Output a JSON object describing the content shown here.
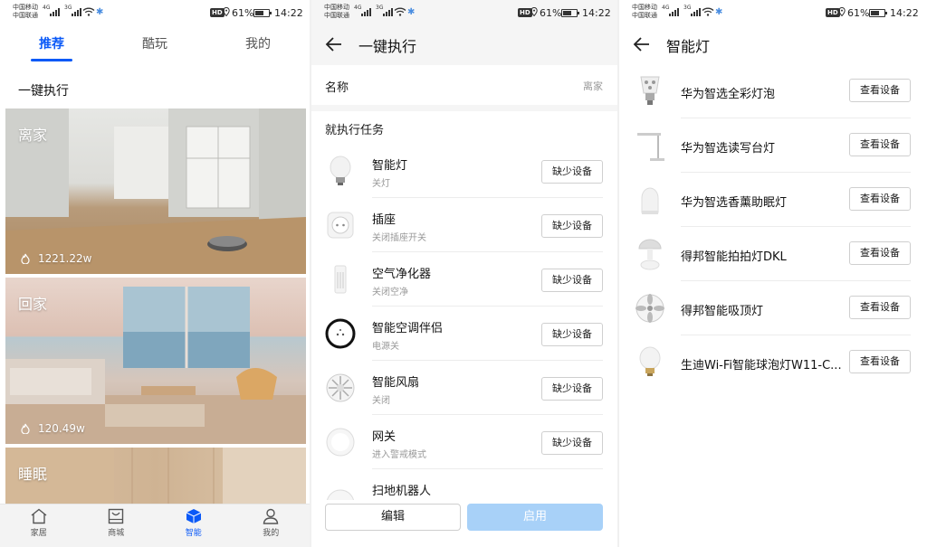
{
  "status": {
    "carrier1": "中国移动",
    "carrier2": "中国联通",
    "net1": "4G",
    "net2": "3G",
    "hd": "HD",
    "battery_pct": "61%",
    "time": "14:22"
  },
  "screen1": {
    "tabs": [
      {
        "label": "推荐",
        "active": true
      },
      {
        "label": "酷玩",
        "active": false
      },
      {
        "label": "我的",
        "active": false
      }
    ],
    "heading": "一键执行",
    "scenes": [
      {
        "name": "离家",
        "count": "1221.22w"
      },
      {
        "name": "回家",
        "count": "120.49w"
      },
      {
        "name": "睡眠",
        "count": ""
      }
    ],
    "bottom_nav": [
      {
        "label": "家居",
        "icon": "home-icon",
        "active": false
      },
      {
        "label": "商城",
        "icon": "store-icon",
        "active": false
      },
      {
        "label": "智能",
        "icon": "smart-cube-icon",
        "active": true
      },
      {
        "label": "我的",
        "icon": "profile-icon",
        "active": false
      }
    ]
  },
  "screen2": {
    "title": "一键执行",
    "name_label": "名称",
    "name_value": "离家",
    "tasks_heading": "就执行任务",
    "tasks": [
      {
        "name": "智能灯",
        "action": "关灯",
        "button": "缺少设备",
        "icon": "bulb-icon"
      },
      {
        "name": "插座",
        "action": "关闭插座开关",
        "button": "缺少设备",
        "icon": "socket-icon"
      },
      {
        "name": "空气净化器",
        "action": "关闭空净",
        "button": "缺少设备",
        "icon": "air-purifier-icon"
      },
      {
        "name": "智能空调伴侣",
        "action": "电源关",
        "button": "缺少设备",
        "icon": "ac-companion-icon"
      },
      {
        "name": "智能风扇",
        "action": "关闭",
        "button": "缺少设备",
        "icon": "fan-icon"
      },
      {
        "name": "网关",
        "action": "进入警戒模式",
        "button": "缺少设备",
        "icon": "gateway-icon"
      },
      {
        "name": "扫地机器人",
        "action": "",
        "button": "",
        "icon": "robot-vacuum-icon"
      }
    ],
    "edit_label": "编辑",
    "enable_label": "启用"
  },
  "screen3": {
    "title": "智能灯",
    "devices": [
      {
        "name": "华为智选全彩灯泡",
        "button": "查看设备",
        "icon": "color-bulb-icon"
      },
      {
        "name": "华为智选读写台灯",
        "button": "查看设备",
        "icon": "desk-lamp-icon"
      },
      {
        "name": "华为智选香薰助眠灯",
        "button": "查看设备",
        "icon": "aroma-lamp-icon"
      },
      {
        "name": "得邦智能拍拍灯DKL",
        "button": "查看设备",
        "icon": "pat-lamp-icon"
      },
      {
        "name": "得邦智能吸顶灯",
        "button": "查看设备",
        "icon": "ceiling-lamp-icon"
      },
      {
        "name": "生迪Wi-Fi智能球泡灯W11-C...",
        "button": "查看设备",
        "icon": "bulb-icon"
      }
    ]
  },
  "colors": {
    "accent": "#0a59f7",
    "disabled_button": "#a8d1f8",
    "secondary_text": "#999999"
  }
}
